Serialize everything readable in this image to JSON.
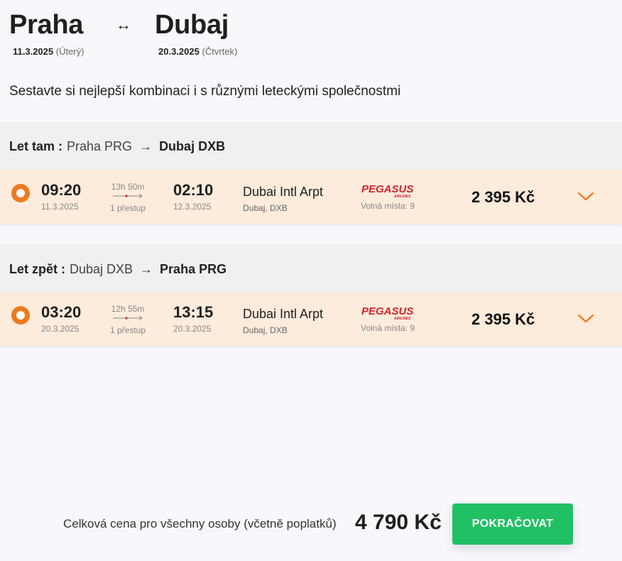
{
  "header": {
    "from_city": "Praha",
    "to_city": "Dubaj",
    "swap_symbol": "↔",
    "from_date": "11.3.2025",
    "from_day": "(Úterý)",
    "to_date": "20.3.2025",
    "to_day": "(Čtvrtek)"
  },
  "subtitle": "Sestavte si nejlepší kombinaci i s různými leteckými společnostmi",
  "outbound": {
    "label": "Let tam :",
    "origin": "Praha PRG",
    "arrow": "→",
    "destination": "Dubaj DXB",
    "flight": {
      "dep_time": "09:20",
      "dep_date": "11.3.2025",
      "duration": "13h 50m",
      "stops": "1 přestup",
      "arr_time": "02:10",
      "arr_date": "12.3.2025",
      "airport": "Dubai Intl Arpt",
      "airport_city": "Dubaj, DXB",
      "airline": "PEGASUS",
      "airline_sub": "AIRLINES",
      "seats": "Volná místa: 9",
      "price": "2 395 Kč"
    }
  },
  "return": {
    "label": "Let zpět :",
    "origin": "Dubaj DXB",
    "arrow": "→",
    "destination": "Praha PRG",
    "flight": {
      "dep_time": "03:20",
      "dep_date": "20.3.2025",
      "duration": "12h 55m",
      "stops": "1 přestup",
      "arr_time": "13:15",
      "arr_date": "20.3.2025",
      "airport": "Dubai Intl Arpt",
      "airport_city": "Dubaj, DXB",
      "airline": "PEGASUS",
      "airline_sub": "AIRLINES",
      "seats": "Volná místa: 9",
      "price": "2 395 Kč"
    }
  },
  "footer": {
    "total_label": "Celková cena pro všechny osoby (včetně poplatků)",
    "total_price": "4 790 Kč",
    "continue_label": "POKRAČOVAT"
  },
  "colors": {
    "accent": "#ee7a1e",
    "row_bg": "#fdebdc",
    "section_bg": "#f0f0f2",
    "button": "#22c065",
    "airline_red": "#d8232a"
  },
  "icons": {
    "swap": "swap-arrows-icon",
    "radio": "radio-selected-icon",
    "expand": "chevron-down-icon",
    "stop": "stopover-arrow-icon"
  }
}
